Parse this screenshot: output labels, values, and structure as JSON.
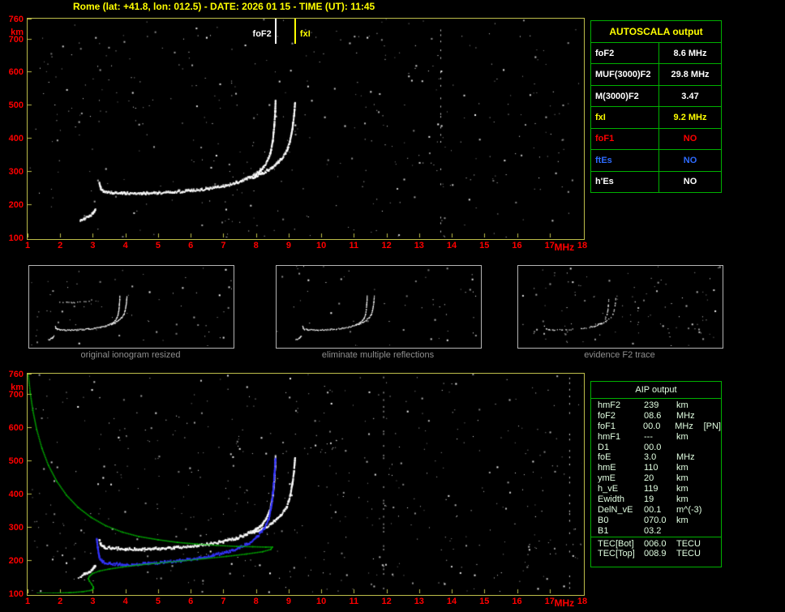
{
  "title": "Rome (lat: +41.8, lon: 012.5) - DATE: 2026 01 15 - TIME (UT): 11:45",
  "colors": {
    "background": "#000000",
    "title_yellow": "#ffff00",
    "axis_label_red": "#ff0000",
    "plot_border": "#bdbd4a",
    "table_border_green": "#00b000",
    "trace_white": "#ffffff",
    "restored_trace_blue": "#3434ff",
    "profile_green": "#00b400",
    "fxI_yellow": "#ffff00",
    "caption_gray": "#8f8f8f"
  },
  "autoscala_table": {
    "title": "AUTOSCALA output",
    "rows": [
      {
        "label": "foF2",
        "value": "8.6 MHz",
        "color": "#ffffff"
      },
      {
        "label": "MUF(3000)F2",
        "value": "29.8 MHz",
        "color": "#ffffff"
      },
      {
        "label": "M(3000)F2",
        "value": "3.47",
        "color": "#ffffff"
      },
      {
        "label": "fxI",
        "value": "9.2 MHz",
        "color": "#ffff00"
      },
      {
        "label": "foF1",
        "value": "NO",
        "color": "#ff0000"
      },
      {
        "label": "ftEs",
        "value": "NO",
        "color": "#2e6bff"
      },
      {
        "label": "h'Es",
        "value": "NO",
        "color": "#ffffff"
      }
    ]
  },
  "aip_table": {
    "title": "AIP output",
    "rows": [
      {
        "label": "hmF2",
        "value": "239",
        "unit": "km",
        "note": ""
      },
      {
        "label": "foF2",
        "value": "08.6",
        "unit": "MHz",
        "note": ""
      },
      {
        "label": "foF1",
        "value": "00.0",
        "unit": "MHz",
        "note": "[PN]"
      },
      {
        "label": "hmF1",
        "value": "---",
        "unit": "km",
        "note": ""
      },
      {
        "label": "D1",
        "value": "00.0",
        "unit": "",
        "note": ""
      },
      {
        "label": "foE",
        "value": "3.0",
        "unit": "MHz",
        "note": ""
      },
      {
        "label": "hmE",
        "value": "110",
        "unit": "km",
        "note": ""
      },
      {
        "label": "ymE",
        "value": "20",
        "unit": "km",
        "note": ""
      },
      {
        "label": "h_vE",
        "value": "119",
        "unit": "km",
        "note": ""
      },
      {
        "label": "Ewidth",
        "value": "19",
        "unit": "km",
        "note": ""
      },
      {
        "label": "DelN_vE",
        "value": "00.1",
        "unit": "m^(-3)",
        "note": ""
      },
      {
        "label": "B0",
        "value": "070.0",
        "unit": "km",
        "note": ""
      },
      {
        "label": "B1",
        "value": "03.2",
        "unit": "",
        "note": ""
      }
    ],
    "tec_rows": [
      {
        "label": "TEC[Bot]",
        "value": "006.0",
        "unit": "TECU"
      },
      {
        "label": "TEC[Top]",
        "value": "008.9",
        "unit": "TECU"
      }
    ]
  },
  "chart_data": [
    {
      "id": "scaled-ionogram",
      "type": "scatter",
      "title": "",
      "xlabel": "MHz",
      "ylabel": "km",
      "xlim": [
        1,
        18
      ],
      "ylim": [
        100,
        760
      ],
      "x_ticks": [
        1,
        2,
        3,
        4,
        5,
        6,
        7,
        8,
        9,
        10,
        11,
        12,
        13,
        14,
        15,
        16,
        17,
        18
      ],
      "y_ticks": [
        100,
        200,
        300,
        400,
        500,
        600,
        700,
        760
      ],
      "grid": false,
      "annotations": [
        {
          "label": "foF2",
          "x": 8.6,
          "color": "#ffffff",
          "side": "left"
        },
        {
          "label": "fxI",
          "x": 9.2,
          "color": "#ffff00",
          "side": "right"
        }
      ],
      "noise_dots": 420,
      "interference": [
        13.65
      ],
      "series": [
        {
          "name": "F2 trace (o-mode)",
          "color": "#ffffff",
          "style": "trace",
          "points": [
            [
              3.2,
              262
            ],
            [
              3.25,
              246
            ],
            [
              3.35,
              238
            ],
            [
              3.6,
              234
            ],
            [
              4.0,
              232
            ],
            [
              4.5,
              232
            ],
            [
              5.0,
              233
            ],
            [
              5.5,
              236
            ],
            [
              6.0,
              240
            ],
            [
              6.5,
              246
            ],
            [
              7.0,
              254
            ],
            [
              7.4,
              264
            ],
            [
              7.7,
              276
            ],
            [
              8.0,
              290
            ],
            [
              8.2,
              307
            ],
            [
              8.35,
              330
            ],
            [
              8.45,
              356
            ],
            [
              8.52,
              394
            ],
            [
              8.56,
              434
            ],
            [
              8.59,
              478
            ],
            [
              8.6,
              508
            ]
          ]
        },
        {
          "name": "F2 trace (x-mode)",
          "color": "#ffffff",
          "style": "trace",
          "points": [
            [
              7.9,
              280
            ],
            [
              8.2,
              292
            ],
            [
              8.5,
              310
            ],
            [
              8.75,
              332
            ],
            [
              8.95,
              360
            ],
            [
              9.05,
              392
            ],
            [
              9.12,
              430
            ],
            [
              9.17,
              470
            ],
            [
              9.2,
              508
            ]
          ]
        },
        {
          "name": "E-region echo",
          "color": "#ffffff",
          "style": "trace",
          "points": [
            [
              2.62,
              150
            ],
            [
              2.75,
              156
            ],
            [
              2.88,
              163
            ],
            [
              3.0,
              172
            ],
            [
              3.08,
              182
            ]
          ]
        }
      ]
    },
    {
      "id": "original-ionogram-resized",
      "type": "scatter",
      "title": "original ionogram resized",
      "xlim": [
        1,
        18
      ],
      "ylim": [
        100,
        760
      ],
      "series_source": 0,
      "density": 1,
      "noise_dots": 70,
      "series": [
        {
          "name": "second-hop echo",
          "color": "#ffffff",
          "style": "trace",
          "density": 0.3,
          "points": [
            [
              3.3,
              470
            ],
            [
              3.7,
              462
            ],
            [
              4.2,
              458
            ],
            [
              4.8,
              458
            ],
            [
              5.4,
              463
            ],
            [
              5.9,
              470
            ],
            [
              6.3,
              480
            ]
          ]
        }
      ]
    },
    {
      "id": "eliminate-multiple-reflections",
      "type": "scatter",
      "title": "eliminate multiple reflections",
      "xlim": [
        1,
        18
      ],
      "ylim": [
        100,
        760
      ],
      "series_source": 0,
      "density": 0.9,
      "noise_dots": 55
    },
    {
      "id": "evidence-f2-trace",
      "type": "scatter",
      "title": "evidence F2 trace",
      "xlim": [
        1,
        18
      ],
      "ylim": [
        100,
        760
      ],
      "series_source": 0,
      "series_filter": "F2",
      "density": 0.45,
      "noise_dots": 110
    },
    {
      "id": "restored-ionogram-and-profile",
      "type": "scatter",
      "title": "",
      "xlabel": "MHz",
      "ylabel": "km",
      "xlim": [
        1,
        18
      ],
      "ylim": [
        100,
        760
      ],
      "x_ticks": [
        1,
        2,
        3,
        4,
        5,
        6,
        7,
        8,
        9,
        10,
        11,
        12,
        13,
        14,
        15,
        16,
        17,
        18
      ],
      "y_ticks": [
        100,
        200,
        300,
        400,
        500,
        600,
        700,
        760
      ],
      "grid": false,
      "series_source": 0,
      "noise_dots": 520,
      "interference": [
        11.9,
        17.6
      ],
      "series": [
        {
          "name": "restored trace",
          "color": "#3434ff",
          "style": "trace",
          "points": [
            [
              3.12,
              262
            ],
            [
              3.16,
              230
            ],
            [
              3.2,
              206
            ],
            [
              3.3,
              194
            ],
            [
              3.5,
              188
            ],
            [
              3.8,
              186
            ],
            [
              4.2,
              186
            ],
            [
              4.7,
              188
            ],
            [
              5.2,
              192
            ],
            [
              5.7,
              197
            ],
            [
              6.2,
              204
            ],
            [
              6.7,
              213
            ],
            [
              7.1,
              223
            ],
            [
              7.5,
              236
            ],
            [
              7.8,
              251
            ],
            [
              8.05,
              270
            ],
            [
              8.25,
              294
            ],
            [
              8.4,
              325
            ],
            [
              8.48,
              365
            ],
            [
              8.53,
              410
            ],
            [
              8.57,
              460
            ],
            [
              8.6,
              505
            ]
          ]
        },
        {
          "name": "electron density profile",
          "color": "#00b400",
          "style": "curve",
          "points": [
            [
              1.02,
              756
            ],
            [
              1.08,
              705
            ],
            [
              1.16,
              650
            ],
            [
              1.28,
              592
            ],
            [
              1.44,
              536
            ],
            [
              1.64,
              484
            ],
            [
              1.9,
              436
            ],
            [
              2.2,
              394
            ],
            [
              2.55,
              358
            ],
            [
              2.95,
              328
            ],
            [
              3.4,
              303
            ],
            [
              3.9,
              284
            ],
            [
              4.4,
              271
            ],
            [
              5.0,
              261
            ],
            [
              5.6,
              253
            ],
            [
              6.2,
              248
            ],
            [
              6.8,
              244
            ],
            [
              7.4,
              241
            ],
            [
              7.9,
              240
            ],
            [
              8.3,
              239
            ],
            [
              8.5,
              239
            ],
            [
              8.45,
              232
            ],
            [
              8.2,
              225
            ],
            [
              7.7,
              218
            ],
            [
              7.1,
              211
            ],
            [
              6.4,
              204
            ],
            [
              5.7,
              197
            ],
            [
              5.0,
              191
            ],
            [
              4.4,
              185
            ],
            [
              3.9,
              179
            ],
            [
              3.5,
              173
            ],
            [
              3.2,
              167
            ],
            [
              3.0,
              160
            ],
            [
              2.9,
              152
            ],
            [
              2.86,
              144
            ],
            [
              2.9,
              136
            ],
            [
              2.96,
              128
            ],
            [
              3.01,
              120
            ],
            [
              3.02,
              114
            ],
            [
              2.95,
              109
            ],
            [
              2.7,
              105
            ],
            [
              2.3,
              102
            ],
            [
              1.8,
              100
            ],
            [
              1.3,
              100
            ]
          ]
        }
      ]
    }
  ]
}
